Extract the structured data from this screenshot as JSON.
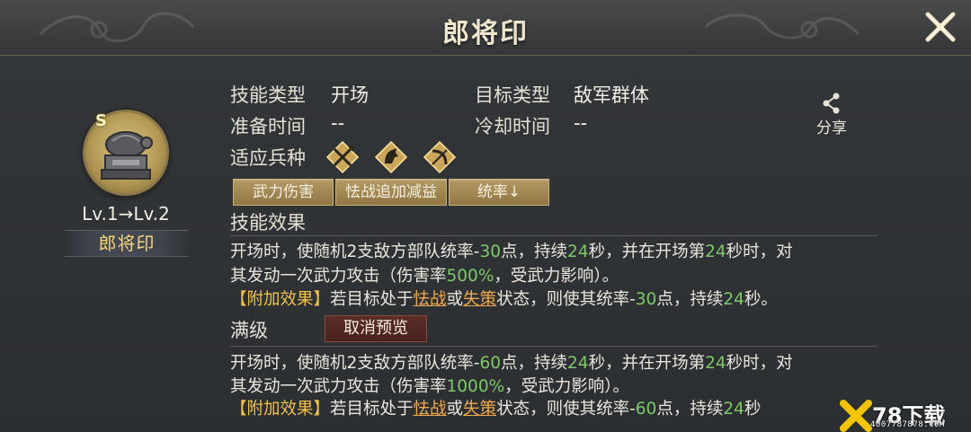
{
  "header": {
    "title": "郎将印",
    "close_icon": "close-x-icon"
  },
  "skill": {
    "grade": "S",
    "level_text": "Lv.1→Lv.2",
    "name": "郎将印",
    "icon": "turtle-seal-icon"
  },
  "info": {
    "skill_type_label": "技能类型",
    "skill_type_value": "开场",
    "target_type_label": "目标类型",
    "target_type_value": "敌军群体",
    "prep_time_label": "准备时间",
    "prep_time_value": "--",
    "cooldown_label": "冷却时间",
    "cooldown_value": "--",
    "troops_label": "适应兵种",
    "troops": [
      "spear-icon",
      "cavalry-icon",
      "bow-icon"
    ]
  },
  "share": {
    "label": "分享",
    "icon": "share-icon"
  },
  "tags": [
    "武力伤害",
    "怯战追加减益",
    "统率↓"
  ],
  "effect": {
    "heading": "技能效果",
    "line1": [
      "开场时，使随机2支敌方部队统率-",
      "30",
      "点，持续",
      "24",
      "秒，并在开场第",
      "24",
      "秒时，对"
    ],
    "line2": [
      "其发动一次武力攻击（伤害率",
      "500%",
      "，受武力影响）。"
    ],
    "line3": [
      "【附加效果】",
      "若目标处于",
      "怯战",
      "或",
      "失策",
      "状态，则使其统率-",
      "30",
      "点，持续",
      "24",
      "秒。"
    ]
  },
  "maxlevel": {
    "heading": "满级",
    "cancel_button": "取消预览",
    "line1": [
      "开场时，使随机2支敌方部队统率-",
      "60",
      "点，持续",
      "24",
      "秒，并在开场第",
      "24",
      "秒时，对"
    ],
    "line2": [
      "其发动一次武力攻击（伤害率",
      "1000%",
      "，受武力影响）。"
    ],
    "line3": [
      "【附加效果】",
      "若目标处于",
      "怯战",
      "或",
      "失策",
      "状态，则使其统率-",
      "60",
      "点，持续",
      "24",
      "秒"
    ]
  },
  "watermark": {
    "main": "78下载",
    "sub": "4007787878.COM"
  },
  "colors": {
    "green": "#7ec86a",
    "gold": "#f1c04c",
    "link": "#f0a94d",
    "name_gold": "#f5d47a"
  }
}
